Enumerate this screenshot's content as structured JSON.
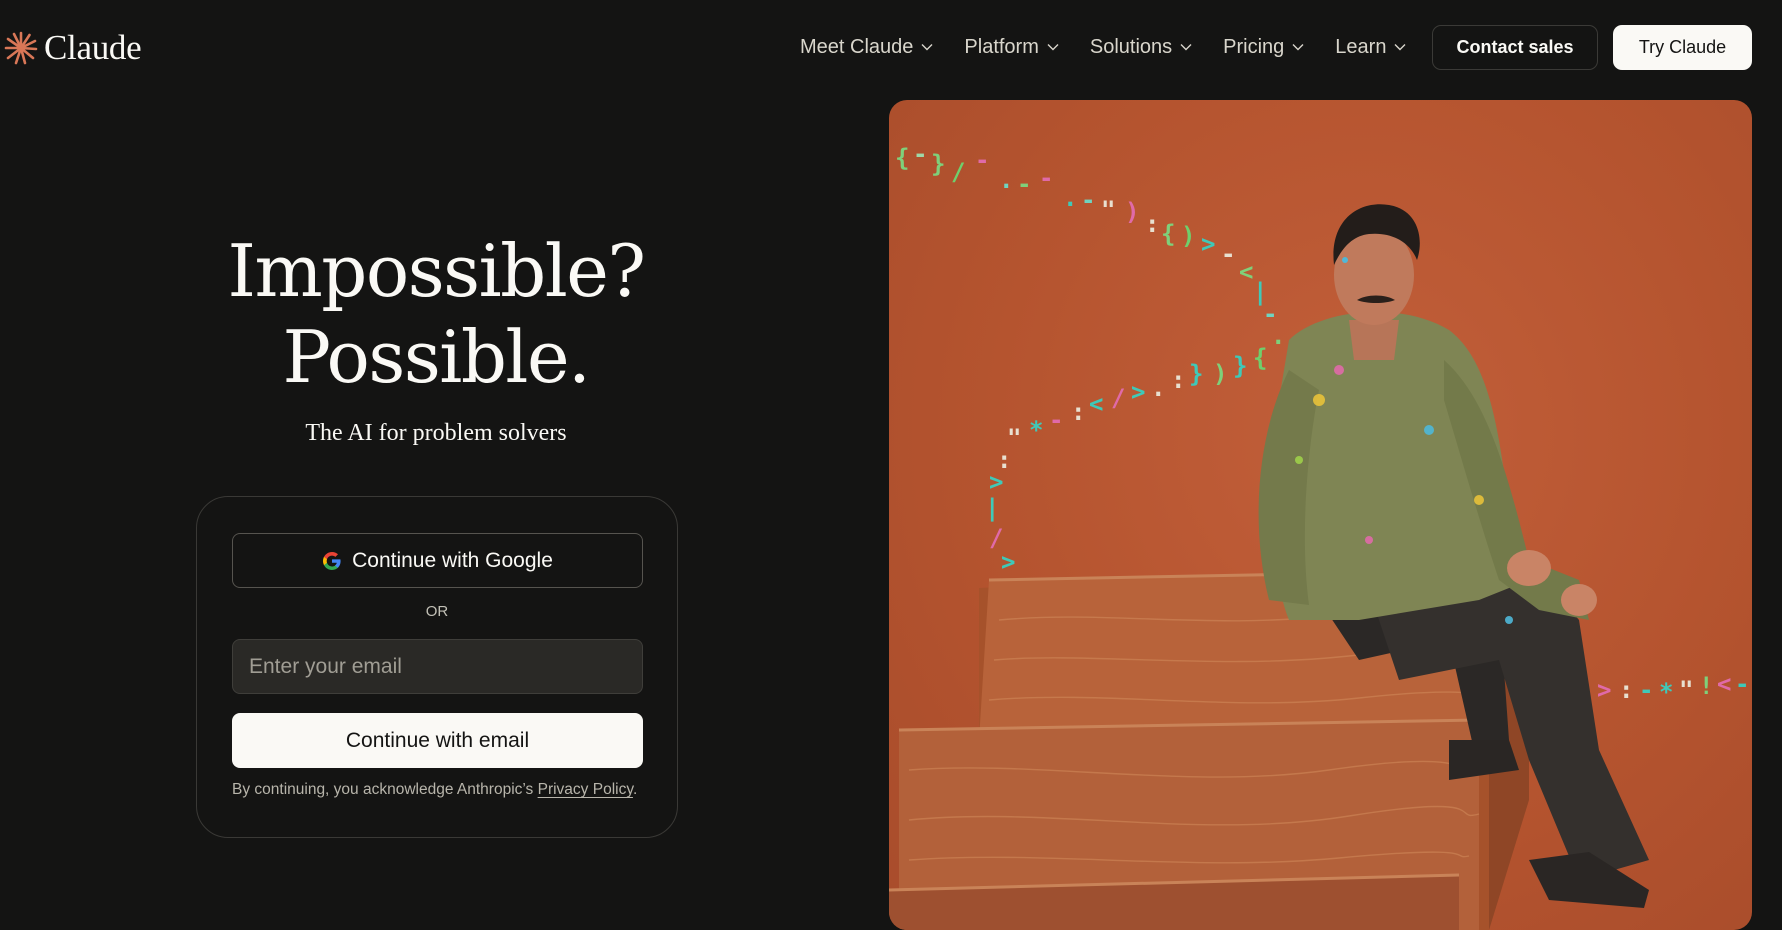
{
  "brand": {
    "name": "Claude",
    "accent": "#d97757"
  },
  "nav": {
    "items": [
      {
        "label": "Meet Claude"
      },
      {
        "label": "Platform"
      },
      {
        "label": "Solutions"
      },
      {
        "label": "Pricing"
      },
      {
        "label": "Learn"
      }
    ],
    "contact_label": "Contact sales",
    "try_label": "Try Claude"
  },
  "hero": {
    "title_line1": "Impossible?",
    "title_line2": "Possible.",
    "subtitle": "The AI for problem solvers"
  },
  "auth": {
    "google_label": "Continue with Google",
    "or_label": "OR",
    "email_placeholder": "Enter your email",
    "email_button_label": "Continue with email",
    "legal_prefix": "By continuing, you acknowledge Anthropic’s",
    "legal_link": "Privacy Policy",
    "legal_suffix": "."
  },
  "icons": {
    "logo": "claude-starburst-icon",
    "nav_chevron": "chevron-down-icon",
    "google": "google-g-icon"
  },
  "colors": {
    "background": "#141413",
    "text": "#faf9f5",
    "image_background": "#b5542f"
  }
}
